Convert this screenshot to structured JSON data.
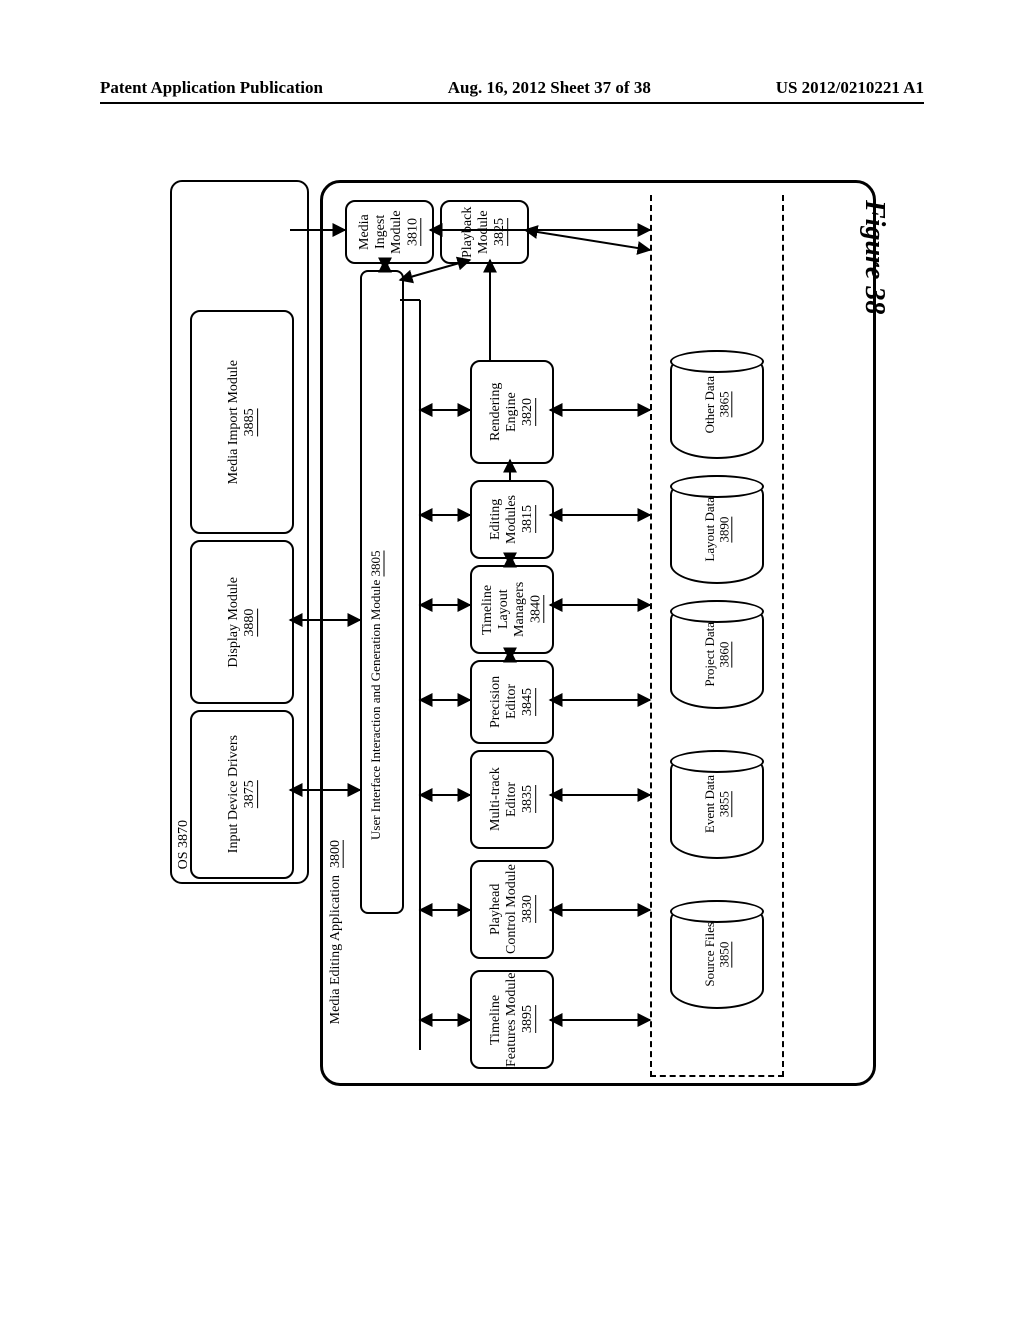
{
  "header": {
    "left": "Patent Application Publication",
    "mid": "Aug. 16, 2012  Sheet 37 of 38",
    "right": "US 2012/0210221 A1"
  },
  "figure_label": "Figure 38",
  "os": {
    "label": "OS",
    "ref": "3870"
  },
  "os_children": {
    "input_drivers": {
      "label": "Input Device Drivers",
      "ref": "3875"
    },
    "display_module": {
      "label": "Display Module",
      "ref": "3880"
    },
    "media_import": {
      "label": "Media Import Module",
      "ref": "3885"
    }
  },
  "app": {
    "label": "Media Editing Application",
    "ref": "3800"
  },
  "ui_module": {
    "label": "User Interface Interaction and Generation Module",
    "ref": "3805"
  },
  "modules": {
    "timeline_features": {
      "label": "Timeline Features Module",
      "ref": "3895"
    },
    "playhead_control": {
      "label": "Playhead Control Module",
      "ref": "3830"
    },
    "multitrack_editor": {
      "label": "Multi-track Editor",
      "ref": "3835"
    },
    "precision_editor": {
      "label": "Precision Editor",
      "ref": "3845"
    },
    "timeline_layout": {
      "label": "Timeline Layout Managers",
      "ref": "3840"
    },
    "editing_modules": {
      "label": "Editing Modules",
      "ref": "3815"
    },
    "rendering_engine": {
      "label": "Rendering Engine",
      "ref": "3820"
    },
    "media_ingest": {
      "label": "Media Ingest Module",
      "ref": "3810"
    },
    "playback_module": {
      "label": "Playback Module",
      "ref": "3825"
    }
  },
  "datastores": {
    "source_files": {
      "label": "Source Files",
      "ref": "3850"
    },
    "event_data": {
      "label": "Event Data",
      "ref": "3855"
    },
    "project_data": {
      "label": "Project Data",
      "ref": "3860"
    },
    "layout_data": {
      "label": "Layout Data",
      "ref": "3890"
    },
    "other_data": {
      "label": "Other Data",
      "ref": "3865"
    }
  }
}
